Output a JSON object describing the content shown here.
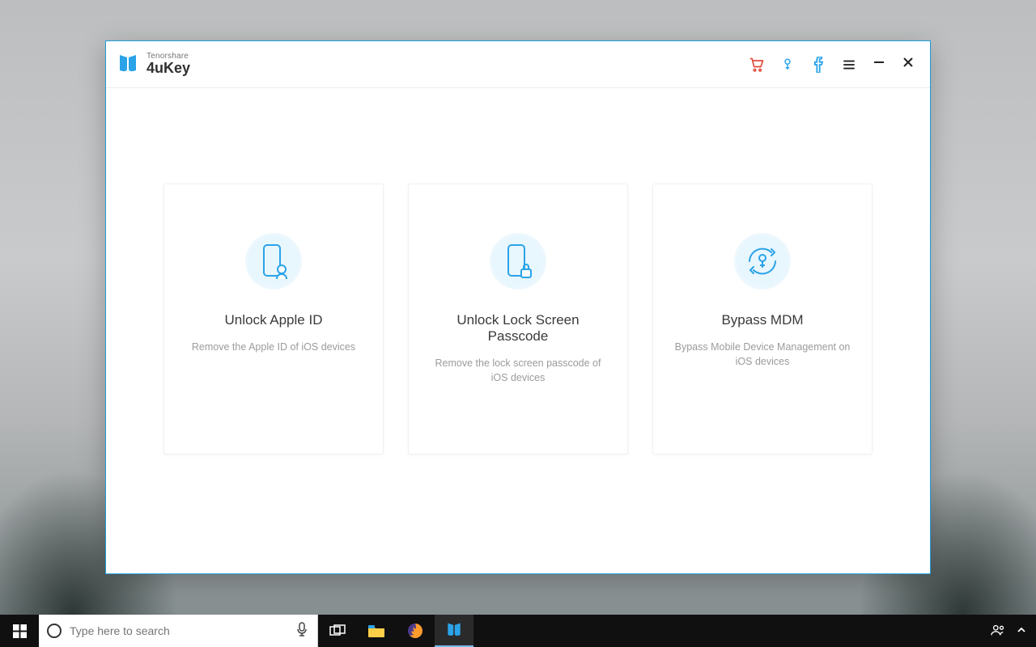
{
  "app": {
    "brand_sub": "Tenorshare",
    "brand_name": "4uKey"
  },
  "cards": [
    {
      "title": "Unlock Apple ID",
      "desc": "Remove the Apple ID of iOS devices"
    },
    {
      "title": "Unlock Lock Screen Passcode",
      "desc": "Remove the lock screen passcode of iOS devices"
    },
    {
      "title": "Bypass MDM",
      "desc": "Bypass Mobile Device Management on iOS devices"
    }
  ],
  "taskbar": {
    "search_placeholder": "Type here to search"
  }
}
